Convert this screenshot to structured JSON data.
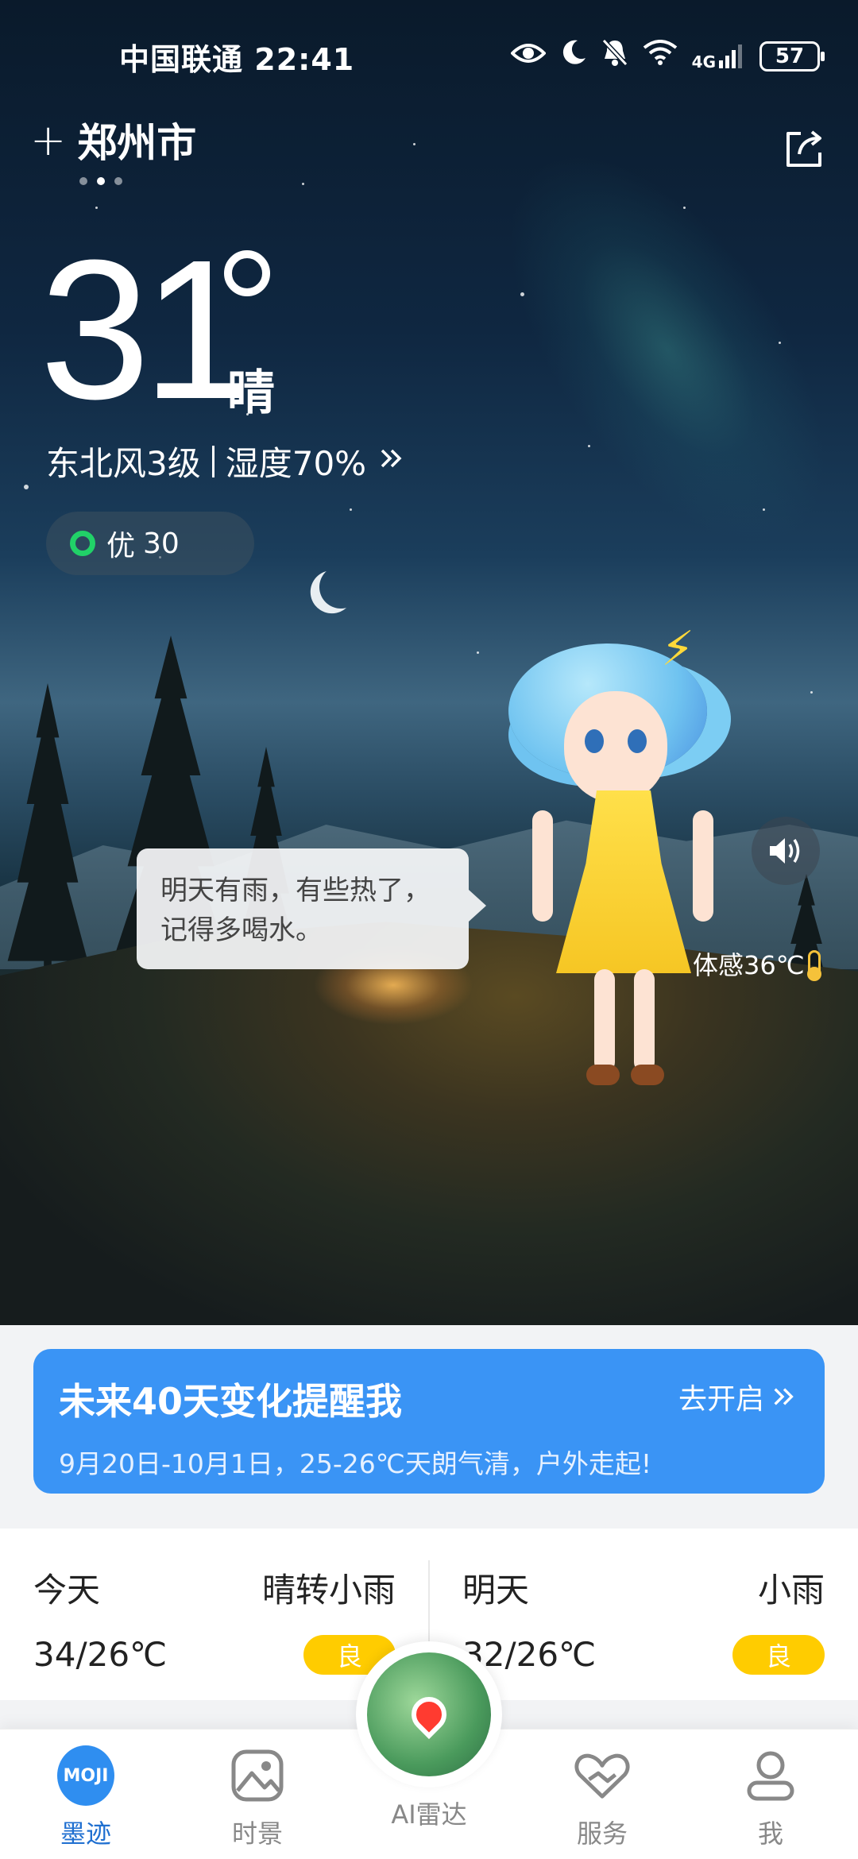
{
  "status_bar": {
    "carrier": "中国联通",
    "time": "22:41",
    "network": "4G",
    "battery": "57"
  },
  "location": {
    "city": "郑州市"
  },
  "current": {
    "temperature": "31",
    "condition": "晴",
    "wind": "东北风3级",
    "humidity": "湿度70%",
    "aqi_label": "优",
    "aqi_value": "30",
    "feels_like": "体感36℃"
  },
  "mascot": {
    "speech": "明天有雨，有些热了，记得多喝水。"
  },
  "alert_card": {
    "title": "未来40天变化提醒我",
    "action": "去开启",
    "description": "9月20日-10月1日，25-26℃天朗气清，户外走起!"
  },
  "forecast": [
    {
      "day": "今天",
      "condition": "晴转小雨",
      "temps": "34/26℃",
      "aqi": "良"
    },
    {
      "day": "明天",
      "condition": "小雨",
      "temps": "32/26℃",
      "aqi": "良"
    }
  ],
  "nav": {
    "items": [
      {
        "label": "墨迹",
        "icon": "moji-logo-icon"
      },
      {
        "label": "时景",
        "icon": "image-icon"
      },
      {
        "label": "AI雷达",
        "icon": "radar-map-icon"
      },
      {
        "label": "服务",
        "icon": "heart-hands-icon"
      },
      {
        "label": "我",
        "icon": "user-icon"
      }
    ],
    "moji_logo": "MOJI"
  },
  "colors": {
    "accent": "#3a94f5",
    "aqi_good": "#21d168",
    "aqi_moderate": "#ffcc00"
  }
}
